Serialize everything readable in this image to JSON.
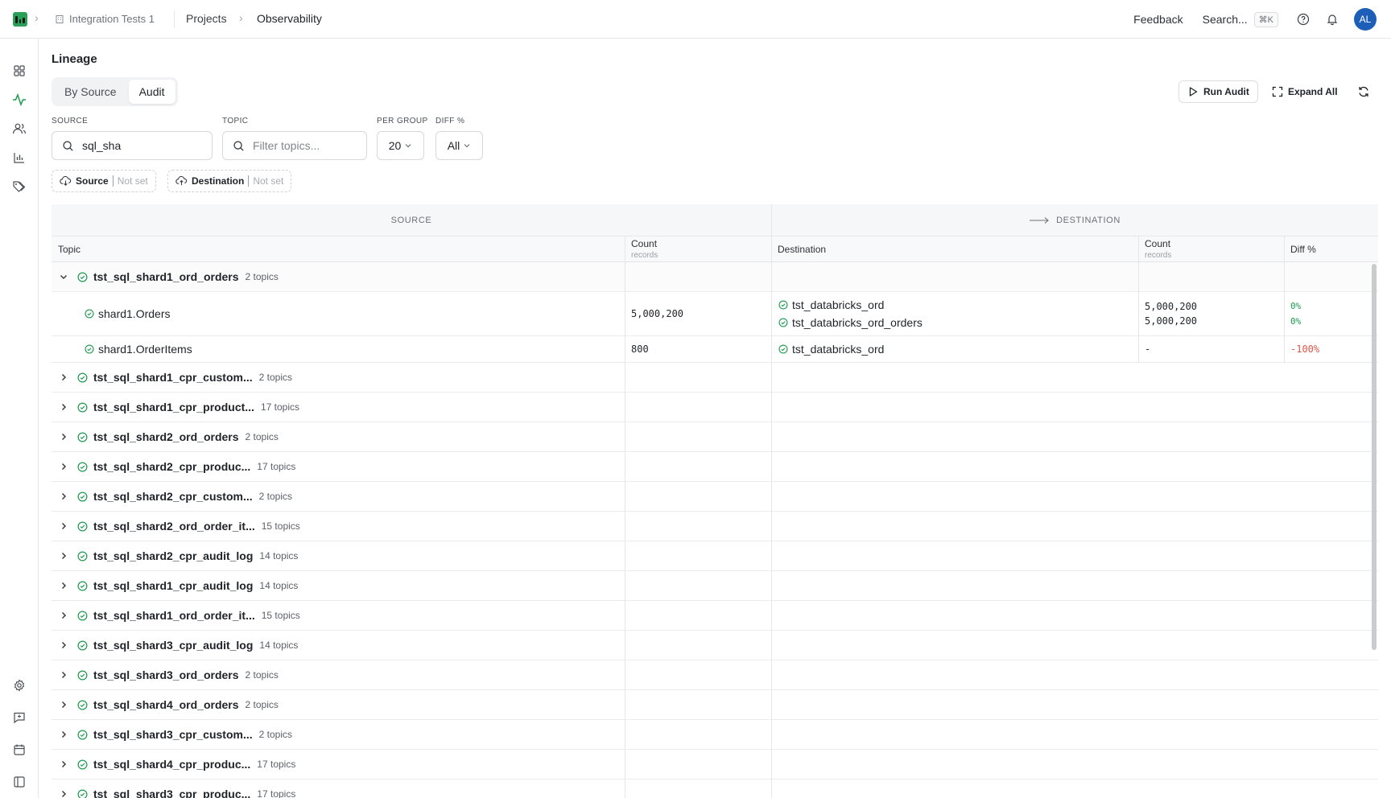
{
  "header": {
    "workspace": "Integration Tests 1",
    "breadcrumb": [
      "Projects",
      "Observability"
    ],
    "feedback": "Feedback",
    "search": "Search...",
    "shortcut": "⌘K",
    "avatar_initials": "AL"
  },
  "page": {
    "title": "Lineage",
    "tabs": [
      "By Source",
      "Audit"
    ],
    "active_tab": "Audit",
    "actions": {
      "run_audit": "Run Audit",
      "expand_all": "Expand All"
    }
  },
  "filters": {
    "source_label": "SOURCE",
    "source_value": "sql_sha",
    "topic_label": "TOPIC",
    "topic_placeholder": "Filter topics...",
    "per_group_label": "PER GROUP",
    "per_group_value": "20",
    "diff_label": "DIFF %",
    "diff_value": "All",
    "chips": [
      {
        "label": "Source",
        "value": "Not set"
      },
      {
        "label": "Destination",
        "value": "Not set"
      }
    ]
  },
  "table": {
    "group_source": "SOURCE",
    "group_destination": "DESTINATION",
    "columns": {
      "topic": "Topic",
      "count": "Count",
      "count_sub": "records",
      "destination": "Destination",
      "diff": "Diff %"
    },
    "expanded": {
      "name": "tst_sql_shard1_ord_orders",
      "count": "2 topics",
      "children": [
        {
          "name": "shard1.Orders",
          "records": "5,000,200",
          "destinations": [
            "tst_databricks_ord",
            "tst_databricks_ord_orders"
          ],
          "dest_records": [
            "5,000,200",
            "5,000,200"
          ],
          "diffs": [
            "0%",
            "0%"
          ]
        },
        {
          "name": "shard1.OrderItems",
          "records": "800",
          "destinations": [
            "tst_databricks_ord"
          ],
          "dest_records": [
            "-"
          ],
          "diffs": [
            "-100%"
          ]
        }
      ]
    },
    "groups": [
      {
        "name": "tst_sql_shard1_cpr_custom...",
        "count": "2 topics"
      },
      {
        "name": "tst_sql_shard1_cpr_product...",
        "count": "17 topics"
      },
      {
        "name": "tst_sql_shard2_ord_orders",
        "count": "2 topics"
      },
      {
        "name": "tst_sql_shard2_cpr_produc...",
        "count": "17 topics"
      },
      {
        "name": "tst_sql_shard2_cpr_custom...",
        "count": "2 topics"
      },
      {
        "name": "tst_sql_shard2_ord_order_it...",
        "count": "15 topics"
      },
      {
        "name": "tst_sql_shard2_cpr_audit_log",
        "count": "14 topics"
      },
      {
        "name": "tst_sql_shard1_cpr_audit_log",
        "count": "14 topics"
      },
      {
        "name": "tst_sql_shard1_ord_order_it...",
        "count": "15 topics"
      },
      {
        "name": "tst_sql_shard3_cpr_audit_log",
        "count": "14 topics"
      },
      {
        "name": "tst_sql_shard3_ord_orders",
        "count": "2 topics"
      },
      {
        "name": "tst_sql_shard4_ord_orders",
        "count": "2 topics"
      },
      {
        "name": "tst_sql_shard3_cpr_custom...",
        "count": "2 topics"
      },
      {
        "name": "tst_sql_shard4_cpr_produc...",
        "count": "17 topics"
      },
      {
        "name": "tst_sql_shard3_cpr_produc...",
        "count": "17 topics"
      }
    ]
  },
  "colors": {
    "accent": "#1d5fb8",
    "ok": "#1e9a4e",
    "negative": "#e0564a",
    "logo": "#2b9e5a"
  }
}
